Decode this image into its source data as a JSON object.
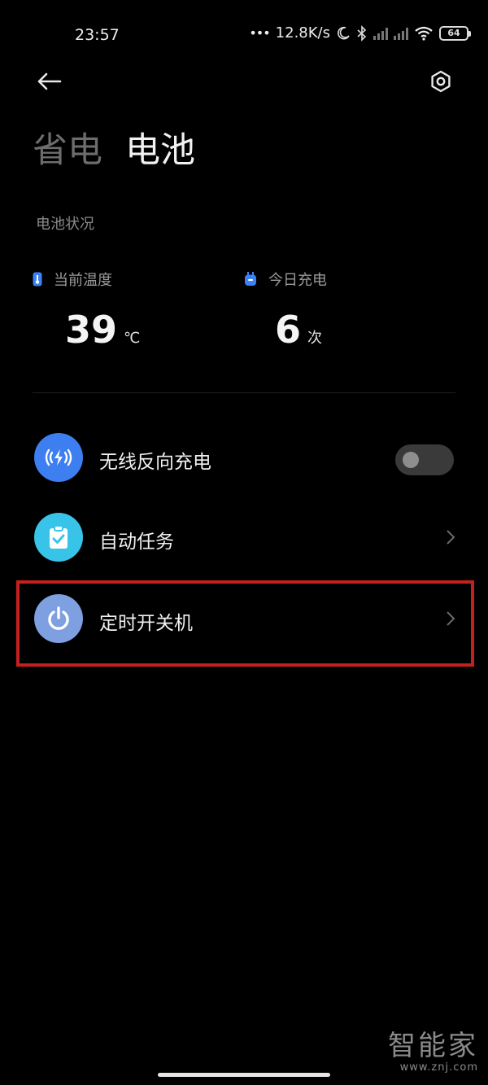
{
  "status_bar": {
    "time": "23:57",
    "net_speed": "12.8K/s",
    "battery_level": "64",
    "icons": [
      "more-dots-icon",
      "moon-icon",
      "bluetooth-icon",
      "signal-icon",
      "signal-icon",
      "wifi-icon",
      "battery-icon"
    ]
  },
  "header": {
    "back_icon": "back-arrow-icon",
    "settings_icon": "settings-gear-icon",
    "tabs": [
      {
        "label": "省电",
        "active": false
      },
      {
        "label": "电池",
        "active": true
      }
    ]
  },
  "battery_status": {
    "section_label": "电池状况",
    "temperature": {
      "label": "当前温度",
      "value": "39",
      "unit": "℃",
      "icon": "thermometer-icon",
      "icon_color": "#3b82f6"
    },
    "charge_today": {
      "label": "今日充电",
      "value": "6",
      "unit": "次",
      "icon": "plug-icon",
      "icon_color": "#3b82f6"
    }
  },
  "settings_list": [
    {
      "label": "无线反向充电",
      "icon": "wireless-charge-icon",
      "icon_color": "#3d7ef0",
      "control": "toggle",
      "toggle_on": false
    },
    {
      "label": "自动任务",
      "icon": "task-clipboard-icon",
      "icon_color": "#38c4e8",
      "control": "chevron"
    },
    {
      "label": "定时开关机",
      "icon": "power-icon",
      "icon_color": "#7e9fe0",
      "control": "chevron"
    }
  ],
  "annotation": {
    "highlight_color": "#c4201d"
  },
  "watermark": {
    "main": "智能家",
    "url": "www.znj.com"
  }
}
